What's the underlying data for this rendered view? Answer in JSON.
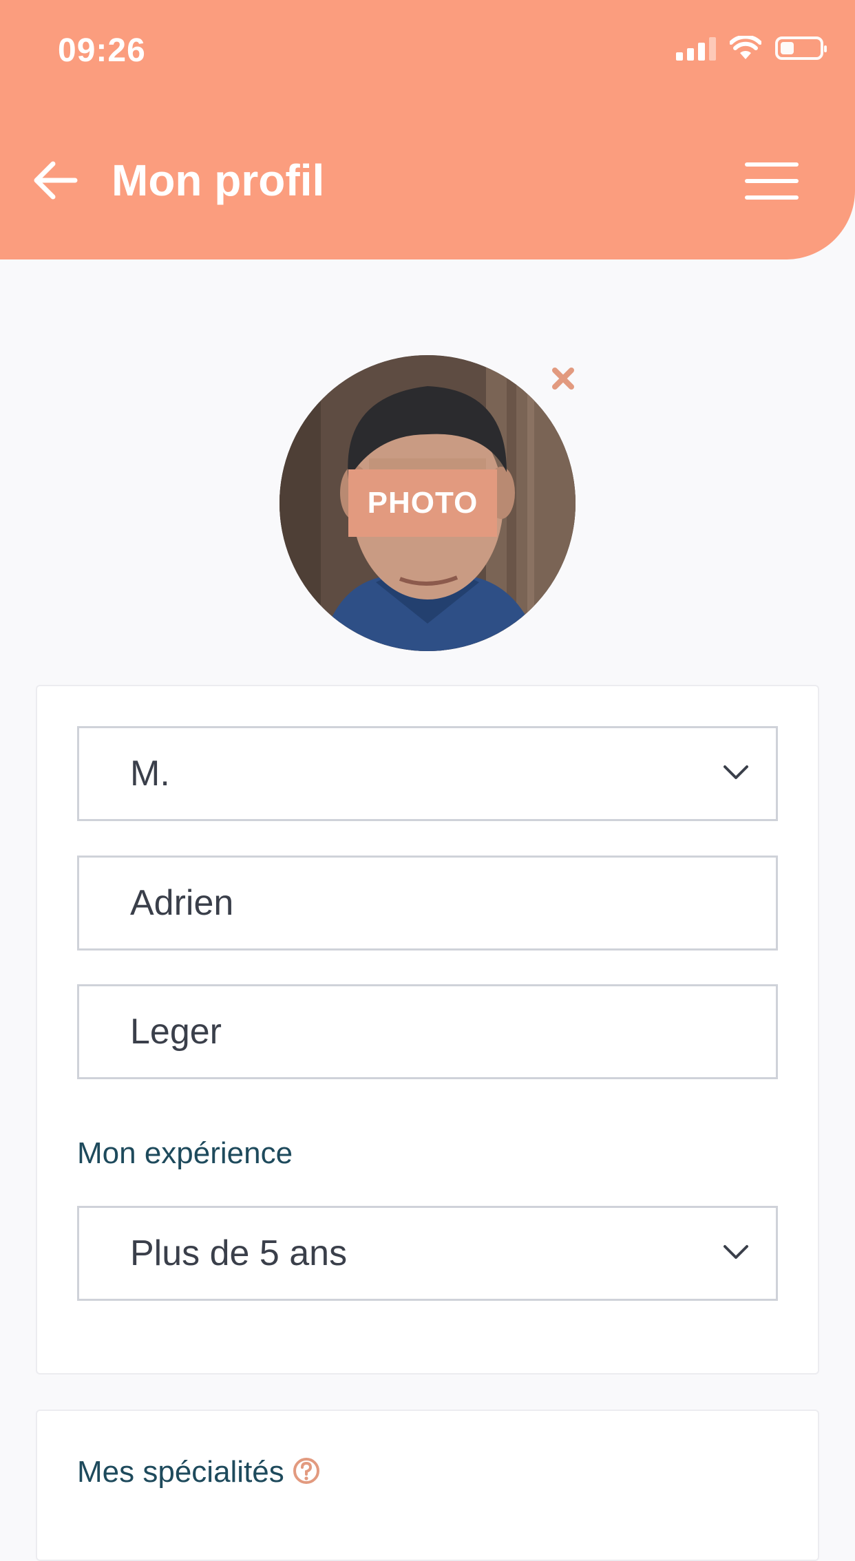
{
  "status_bar": {
    "time": "09:26",
    "battery_level": 0.35
  },
  "header": {
    "title": "Mon profil",
    "back_icon": "arrow-left-icon",
    "menu_icon": "hamburger-menu-icon",
    "background_color": "#fb9d7e"
  },
  "profile_photo": {
    "badge_label": "PHOTO",
    "remove_icon": "close-icon",
    "accent_color": "#e29a7f"
  },
  "identity_form": {
    "civility": "M.",
    "first_name": "Adrien",
    "last_name": "Leger",
    "experience_label": "Mon expérience",
    "experience_value": "Plus de 5 ans"
  },
  "specialties": {
    "label": "Mes spécialités",
    "help_icon": "question-circle-icon"
  }
}
